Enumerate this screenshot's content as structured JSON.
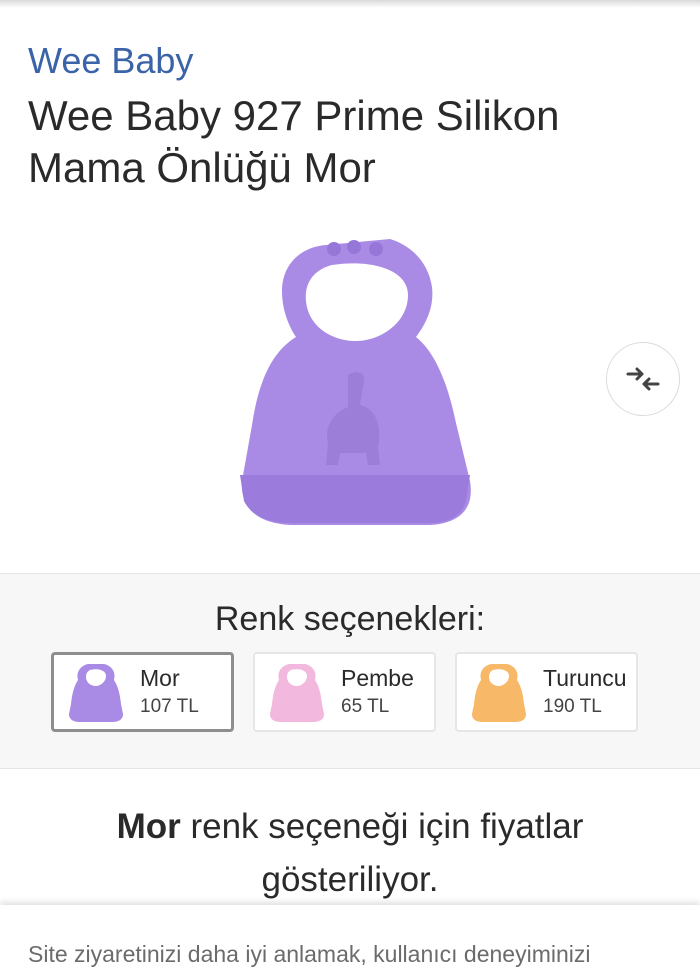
{
  "brand": "Wee Baby",
  "product": {
    "title": "Wee Baby 927 Prime Silikon Mama Önlüğü Mor",
    "image_icon": "purple-silicone-bib",
    "compare_icon": "compare-arrows-icon"
  },
  "colors": {
    "heading": "Renk seçenekleri:",
    "options": [
      {
        "name": "Mor",
        "price": "107 TL",
        "color": "#a98be6",
        "selected": true
      },
      {
        "name": "Pembe",
        "price": "65 TL",
        "color": "#f2b8dd",
        "selected": false
      },
      {
        "name": "Turuncu",
        "price": "190 TL",
        "color": "#f7b867",
        "selected": false
      }
    ]
  },
  "notice": {
    "bold": "Mor",
    "text": " renk seçeneği için fiyatlar gösteriliyor."
  },
  "cookie": {
    "text": "Site ziyaretinizi daha iyi anlamak, kullanıcı deneyiminizi"
  },
  "theme": {
    "brand_color": "#3b63a8",
    "bib_color": "#a98be6"
  }
}
